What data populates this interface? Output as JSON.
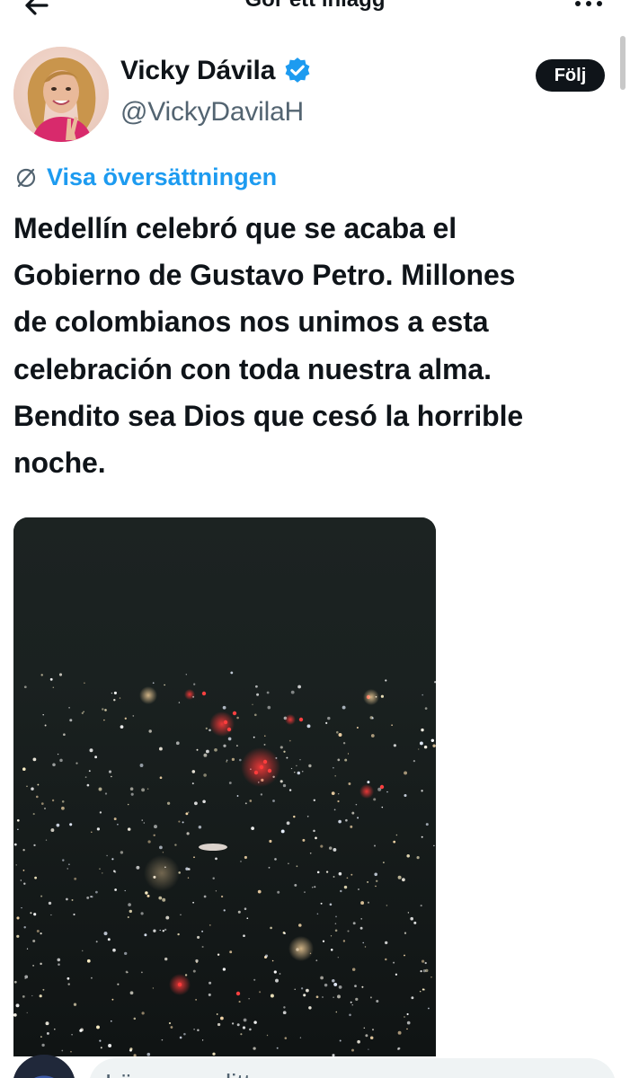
{
  "header": {
    "title": "Gör ett inlägg",
    "back_icon": "arrow-left-icon",
    "more_icon": "more-dots-icon"
  },
  "author": {
    "display_name": "Vicky Dávila",
    "handle": "@VickyDavilaH",
    "verified_icon": "verified-badge-icon",
    "verified_color": "#1d9bf0"
  },
  "follow_button": {
    "label": "Följ"
  },
  "translate": {
    "icon": "globe-icon",
    "label": "Visa översättningen",
    "color": "#1d9bf0"
  },
  "tweet": {
    "lines": [
      "Medellín celebró que se acaba el",
      "Gobierno de Gustavo Petro. Millones",
      "de colombianos nos unimos a esta",
      "celebración con toda nuestra alma.",
      "Bendito sea Dios que cesó la horrible",
      "noche."
    ]
  },
  "media": {
    "description_icon": "video-thumbnail-icon"
  },
  "reply": {
    "placeholder": "Lägg upp ditt svar"
  }
}
